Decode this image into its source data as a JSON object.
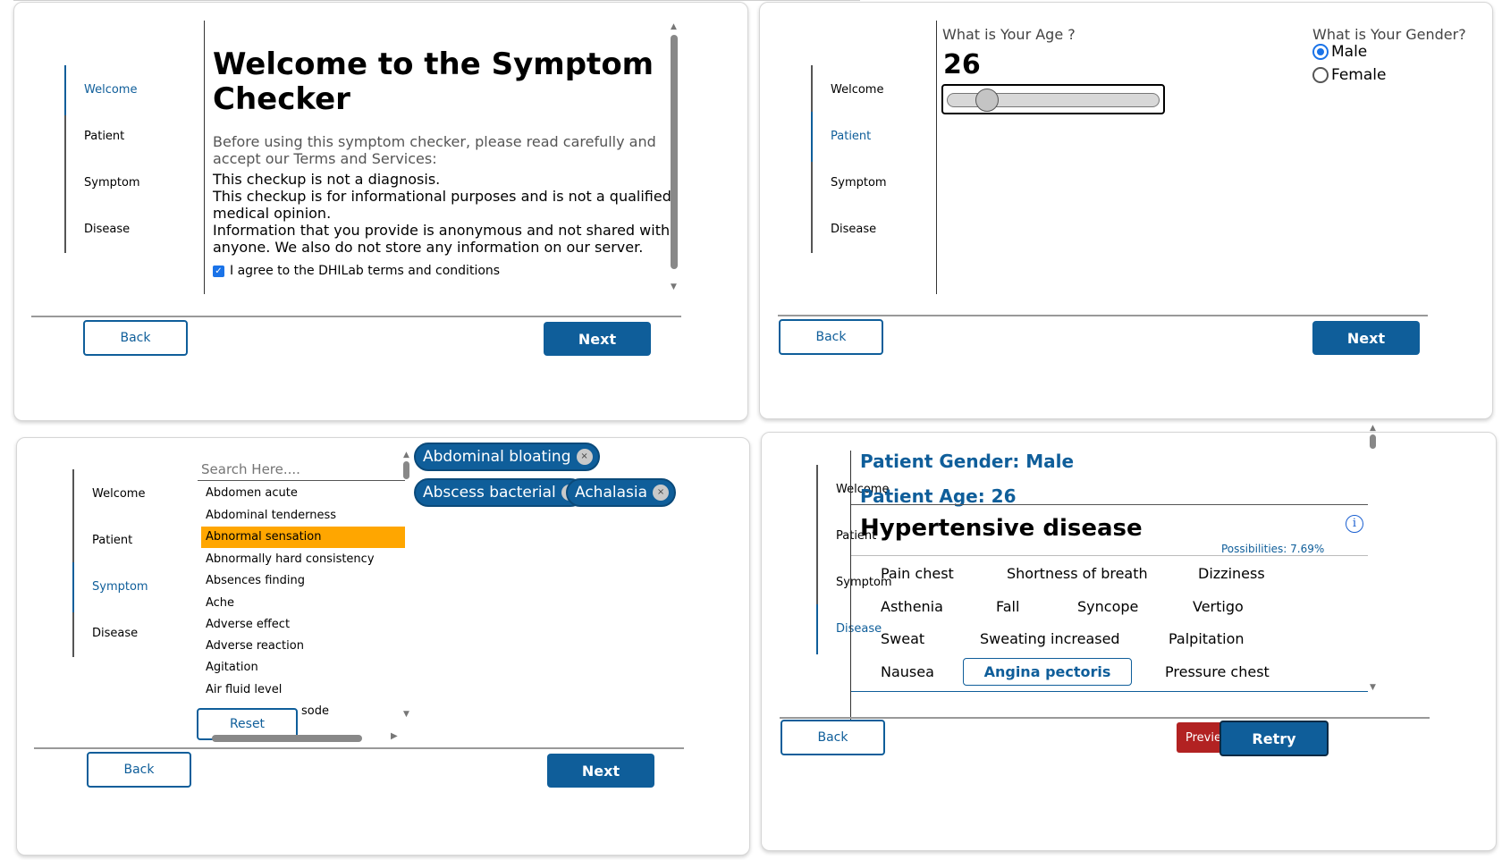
{
  "nav": {
    "welcome": "Welcome",
    "patient": "Patient",
    "symptom": "Symptom",
    "disease": "Disease"
  },
  "buttons": {
    "back": "Back",
    "next": "Next",
    "reset": "Reset",
    "preview": "Previe",
    "retry": "Retry"
  },
  "welcome_screen": {
    "title": "Welcome to the Symptom Checker",
    "intro": "Before using this symptom checker, please read carefully and accept our Terms and Services:",
    "line1": "This checkup is not a diagnosis.",
    "line2": "This checkup is for informational purposes and is not a qualified medical opinion.",
    "line3": "Information that you provide is anonymous and not shared with anyone. We also do not store any information on our server.",
    "agree_label": "I agree to the DHILab terms and conditions",
    "agree_checked": true
  },
  "patient_screen": {
    "age_question": "What is Your Age ?",
    "age_value": "26",
    "gender_question": "What is Your Gender?",
    "gender_options": [
      "Male",
      "Female"
    ],
    "gender_selected": "Male"
  },
  "symptom_screen": {
    "search_placeholder": "Search Here....",
    "options": [
      "Abdomen acute",
      "Abdominal tenderness",
      "Abnormal sensation",
      "Abnormally hard consistency",
      "Absences finding",
      "Ache",
      "Adverse effect",
      "Adverse reaction",
      "Agitation",
      "Air fluid level",
      "sode"
    ],
    "highlighted_option": "Abnormal sensation",
    "selected_chips": [
      "Abdominal bloating",
      "Abscess bacterial",
      "Achalasia"
    ],
    "chip_remove_glyph": "×"
  },
  "disease_screen": {
    "gender_line": "Patient Gender: Male",
    "age_line": "Patient Age: 26",
    "disease_name": "Hypertensive disease",
    "info_glyph": "i",
    "possibilities": "Possibilities: 7.69%",
    "symptoms": [
      "Pain chest",
      "Shortness of breath",
      "Dizziness",
      "Asthenia",
      "Fall",
      "Syncope",
      "Vertigo",
      "Sweat",
      "Sweating increased",
      "Palpitation",
      "Nausea",
      "Angina pectoris",
      "Pressure chest"
    ],
    "highlighted_symptom": "Angina pectoris"
  },
  "colors": {
    "primary": "#0f5e9a",
    "highlight": "#ffa600",
    "danger": "#b22222",
    "checkbox": "#1a73e8"
  }
}
